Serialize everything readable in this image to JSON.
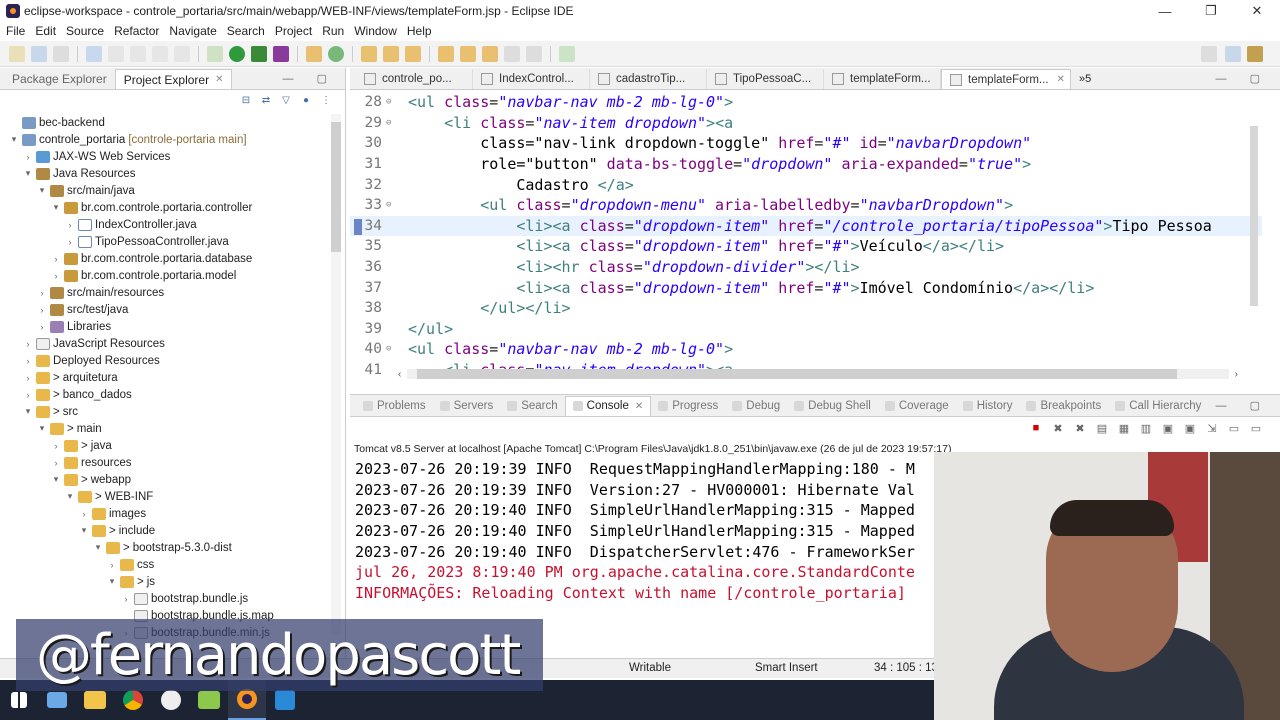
{
  "window": {
    "title": "eclipse-workspace - controle_portaria/src/main/webapp/WEB-INF/views/templateForm.jsp - Eclipse IDE",
    "controls": [
      "—",
      "❐",
      "✕"
    ]
  },
  "menu": [
    "File",
    "Edit",
    "Source",
    "Refactor",
    "Navigate",
    "Search",
    "Project",
    "Run",
    "Window",
    "Help"
  ],
  "left_panel": {
    "tabs": [
      {
        "label": "Package Explorer",
        "active": false
      },
      {
        "label": "Project Explorer",
        "active": true
      }
    ],
    "tree": [
      {
        "label": "bec-backend",
        "depth": 0,
        "twisty": "",
        "icon": "project",
        "extra": ""
      },
      {
        "label": "controle_portaria",
        "depth": 0,
        "twisty": "▾",
        "icon": "project",
        "extra": "[controle-portaria main]"
      },
      {
        "label": "JAX-WS Web Services",
        "depth": 1,
        "twisty": "›",
        "icon": "web",
        "extra": ""
      },
      {
        "label": "Java Resources",
        "depth": 1,
        "twisty": "▾",
        "icon": "src",
        "extra": ""
      },
      {
        "label": "src/main/java",
        "depth": 2,
        "twisty": "▾",
        "icon": "src",
        "extra": ""
      },
      {
        "label": "br.com.controle.portaria.controller",
        "depth": 3,
        "twisty": "▾",
        "icon": "pkg",
        "extra": ""
      },
      {
        "label": "IndexController.java",
        "depth": 4,
        "twisty": "›",
        "icon": "java",
        "extra": ""
      },
      {
        "label": "TipoPessoaController.java",
        "depth": 4,
        "twisty": "›",
        "icon": "java",
        "extra": ""
      },
      {
        "label": "br.com.controle.portaria.database",
        "depth": 3,
        "twisty": "›",
        "icon": "pkg",
        "extra": ""
      },
      {
        "label": "br.com.controle.portaria.model",
        "depth": 3,
        "twisty": "›",
        "icon": "pkg",
        "extra": ""
      },
      {
        "label": "src/main/resources",
        "depth": 2,
        "twisty": "›",
        "icon": "src",
        "extra": ""
      },
      {
        "label": "src/test/java",
        "depth": 2,
        "twisty": "›",
        "icon": "src",
        "extra": ""
      },
      {
        "label": "Libraries",
        "depth": 2,
        "twisty": "›",
        "icon": "lib",
        "extra": ""
      },
      {
        "label": "JavaScript Resources",
        "depth": 1,
        "twisty": "›",
        "icon": "js",
        "extra": ""
      },
      {
        "label": "Deployed Resources",
        "depth": 1,
        "twisty": "›",
        "icon": "folder",
        "extra": ""
      },
      {
        "label": "arquitetura",
        "depth": 1,
        "twisty": "›",
        "icon": "folder",
        "extra": ">"
      },
      {
        "label": "banco_dados",
        "depth": 1,
        "twisty": "›",
        "icon": "folder",
        "extra": ">"
      },
      {
        "label": "src",
        "depth": 1,
        "twisty": "▾",
        "icon": "folder",
        "extra": ">"
      },
      {
        "label": "main",
        "depth": 2,
        "twisty": "▾",
        "icon": "folder",
        "extra": ">"
      },
      {
        "label": "java",
        "depth": 3,
        "twisty": "›",
        "icon": "folder",
        "extra": ">"
      },
      {
        "label": "resources",
        "depth": 3,
        "twisty": "›",
        "icon": "folder",
        "extra": ""
      },
      {
        "label": "webapp",
        "depth": 3,
        "twisty": "▾",
        "icon": "folder",
        "extra": ">"
      },
      {
        "label": "WEB-INF",
        "depth": 4,
        "twisty": "▾",
        "icon": "folder",
        "extra": ">"
      },
      {
        "label": "images",
        "depth": 5,
        "twisty": "›",
        "icon": "folder",
        "extra": ""
      },
      {
        "label": "include",
        "depth": 5,
        "twisty": "▾",
        "icon": "folder",
        "extra": ">"
      },
      {
        "label": "bootstrap-5.3.0-dist",
        "depth": 6,
        "twisty": "▾",
        "icon": "folder",
        "extra": ">"
      },
      {
        "label": "css",
        "depth": 7,
        "twisty": "›",
        "icon": "folder",
        "extra": ""
      },
      {
        "label": "js",
        "depth": 7,
        "twisty": "▾",
        "icon": "folder",
        "extra": ">"
      },
      {
        "label": "bootstrap.bundle.js",
        "depth": 8,
        "twisty": "›",
        "icon": "js",
        "extra": ""
      },
      {
        "label": "bootstrap.bundle.js.map",
        "depth": 8,
        "twisty": "",
        "icon": "js",
        "extra": ""
      },
      {
        "label": "bootstrap.bundle.min.js",
        "depth": 8,
        "twisty": "›",
        "icon": "js",
        "extra": ""
      }
    ]
  },
  "editor": {
    "tabs": [
      {
        "label": "controle_po...",
        "active": false
      },
      {
        "label": "IndexControl...",
        "active": false
      },
      {
        "label": "cadastroTip...",
        "active": false
      },
      {
        "label": "TipoPessoaC...",
        "active": false
      },
      {
        "label": "templateForm...",
        "active": false
      },
      {
        "label": "templateForm...",
        "active": true
      }
    ],
    "overflow": "»5",
    "lines": [
      {
        "n": "28",
        "fold": "⊖",
        "indent": "",
        "text": "<ul class=\"navbar-nav mb-2 mb-lg-0\">"
      },
      {
        "n": "29",
        "fold": "⊖",
        "indent": "    ",
        "text": "<li class=\"nav-item dropdown\"><a"
      },
      {
        "n": "30",
        "fold": "",
        "indent": "        ",
        "text": "class=\"nav-link dropdown-toggle\" href=\"#\" id=\"navbarDropdown\""
      },
      {
        "n": "31",
        "fold": "",
        "indent": "        ",
        "text": "role=\"button\" data-bs-toggle=\"dropdown\" aria-expanded=\"true\">"
      },
      {
        "n": "32",
        "fold": "",
        "indent": "            ",
        "text": "Cadastro </a>"
      },
      {
        "n": "33",
        "fold": "⊖",
        "indent": "        ",
        "text": "<ul class=\"dropdown-menu\" aria-labelledby=\"navbarDropdown\">"
      },
      {
        "n": "34",
        "fold": "",
        "indent": "            ",
        "text": "<li><a class=\"dropdown-item\" href=\"/controle_portaria/tipoPessoa\">Tipo Pessoa"
      },
      {
        "n": "35",
        "fold": "",
        "indent": "            ",
        "text": "<li><a class=\"dropdown-item\" href=\"#\">Veículo</a></li>"
      },
      {
        "n": "36",
        "fold": "",
        "indent": "            ",
        "text": "<li><hr class=\"dropdown-divider\"></li>"
      },
      {
        "n": "37",
        "fold": "",
        "indent": "            ",
        "text": "<li><a class=\"dropdown-item\" href=\"#\">Imóvel Condomínio</a></li>"
      },
      {
        "n": "38",
        "fold": "",
        "indent": "        ",
        "text": "</ul></li>"
      },
      {
        "n": "39",
        "fold": "",
        "indent": "",
        "text": "</ul>"
      },
      {
        "n": "40",
        "fold": "⊖",
        "indent": "",
        "text": "<ul class=\"navbar-nav mb-2 mb-lg-0\">"
      },
      {
        "n": "41",
        "fold": "",
        "indent": "    ",
        "text": "<li class=\"nav-item dropdown\"><a"
      }
    ]
  },
  "console": {
    "tabs": [
      "Problems",
      "Servers",
      "Search",
      "Console",
      "Progress",
      "Debug",
      "Debug Shell",
      "Coverage",
      "History",
      "Breakpoints",
      "Call Hierarchy"
    ],
    "active_tab": "Console",
    "header": "Tomcat v8.5 Server at localhost [Apache Tomcat] C:\\Program Files\\Java\\jdk1.8.0_251\\bin\\javaw.exe  (26 de jul de 2023 19:57:17)",
    "lines": [
      {
        "text": "2023-07-26 20:19:39 INFO  RequestMappingHandlerMapping:180 - M",
        "type": "info"
      },
      {
        "text": "2023-07-26 20:19:39 INFO  Version:27 - HV000001: Hibernate Val",
        "type": "info"
      },
      {
        "text": "2023-07-26 20:19:40 INFO  SimpleUrlHandlerMapping:315 - Mapped",
        "type": "info"
      },
      {
        "text": "2023-07-26 20:19:40 INFO  SimpleUrlHandlerMapping:315 - Mapped",
        "type": "info"
      },
      {
        "text": "2023-07-26 20:19:40 INFO  DispatcherServlet:476 - FrameworkSer",
        "type": "info"
      },
      {
        "text": "jul 26, 2023 8:19:40 PM org.apache.catalina.core.StandardConte",
        "type": "err"
      },
      {
        "text": "INFORMAÇÕES: Reloading Context with name [/controle_portaria]",
        "type": "err"
      }
    ]
  },
  "status": {
    "writable": "Writable",
    "insert_mode": "Smart Insert",
    "position": "34 : 105 : 13"
  },
  "watermark": "@fernandopascott",
  "colors": {
    "tag": "#3f7f7f",
    "attr": "#7f007f",
    "value": "#2a00ff",
    "console_error": "#c8102e",
    "taskbar": "#1c2433"
  },
  "taskbar_apps": [
    "windows-start-icon",
    "file-explorer-icon",
    "chrome-icon",
    "github-desktop-icon",
    "notepad-plus-icon",
    "eclipse-icon",
    "vscode-icon"
  ]
}
